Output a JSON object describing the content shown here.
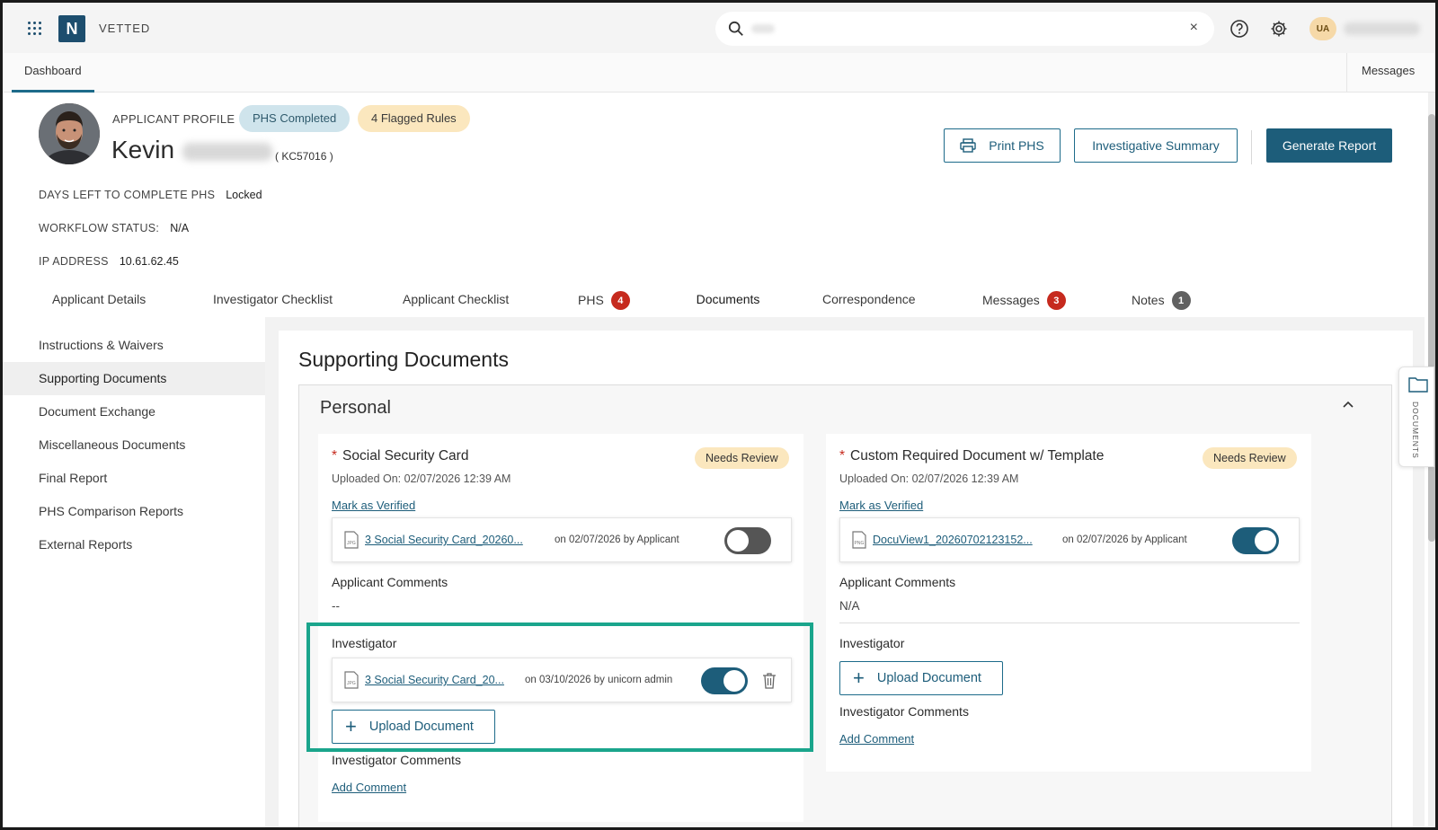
{
  "app": {
    "name": "VETTED",
    "logo_letter": "N",
    "user_initials": "UA"
  },
  "search": {
    "placeholder": "",
    "clear_label": "×"
  },
  "nav": {
    "dashboard": "Dashboard",
    "messages": "Messages"
  },
  "profile": {
    "label": "APPLICANT PROFILE",
    "badge_status": "PHS Completed",
    "badge_flags": "4 Flagged Rules",
    "first_name": "Kevin",
    "id": "( KC57016 )",
    "days_left_label": "DAYS LEFT TO COMPLETE PHS",
    "days_left_value": "Locked",
    "workflow_label": "WORKFLOW STATUS:",
    "workflow_value": "N/A",
    "ip_label": "IP ADDRESS",
    "ip_value": "10.61.62.45"
  },
  "actions": {
    "print": "Print PHS",
    "summary": "Investigative Summary",
    "generate": "Generate Report"
  },
  "tabs": [
    {
      "label": "Applicant Details"
    },
    {
      "label": "Investigator Checklist"
    },
    {
      "label": "Applicant Checklist"
    },
    {
      "label": "PHS",
      "count": "4"
    },
    {
      "label": "Documents"
    },
    {
      "label": "Correspondence"
    },
    {
      "label": "Messages",
      "count": "3"
    },
    {
      "label": "Notes",
      "count": "1"
    }
  ],
  "sidebar": [
    "Instructions & Waivers",
    "Supporting Documents",
    "Document Exchange",
    "Miscellaneous Documents",
    "Final Report",
    "PHS Comparison Reports",
    "External Reports"
  ],
  "main": {
    "title": "Supporting Documents",
    "section": "Personal",
    "side_tab": "DOCUMENTS",
    "cards": [
      {
        "title": "Social Security Card",
        "status": "Needs Review",
        "uploaded": "Uploaded On: 02/07/2026 12:39 AM",
        "verify": "Mark as Verified",
        "file_type": "JPG",
        "file_name": "3 Social Security Card_20260...",
        "file_meta": "on 02/07/2026 by Applicant",
        "applicant_comments_label": "Applicant Comments",
        "applicant_comments": "--",
        "investigator_label": "Investigator",
        "inv_file_type": "JPG",
        "inv_file_name": "3 Social Security Card_20...",
        "inv_file_meta": "on 03/10/2026 by unicorn admin",
        "upload": "Upload Document",
        "investigator_comments_label": "Investigator Comments",
        "add_comment": "Add Comment"
      },
      {
        "title": "Custom Required Document w/ Template",
        "status": "Needs Review",
        "uploaded": "Uploaded On: 02/07/2026 12:39 AM",
        "verify": "Mark as Verified",
        "file_type": "PNG",
        "file_name": "DocuView1_20260702123152...",
        "file_meta": "on 02/07/2026 by Applicant",
        "applicant_comments_label": "Applicant Comments",
        "applicant_comments": "N/A",
        "investigator_label": "Investigator",
        "upload": "Upload Document",
        "investigator_comments_label": "Investigator Comments",
        "add_comment": "Add Comment"
      }
    ]
  },
  "colors": {
    "primary": "#1d5d7a",
    "badge_red": "#c62a1e",
    "highlight": "#1aa58c",
    "needs_review": "#fbe7be"
  }
}
